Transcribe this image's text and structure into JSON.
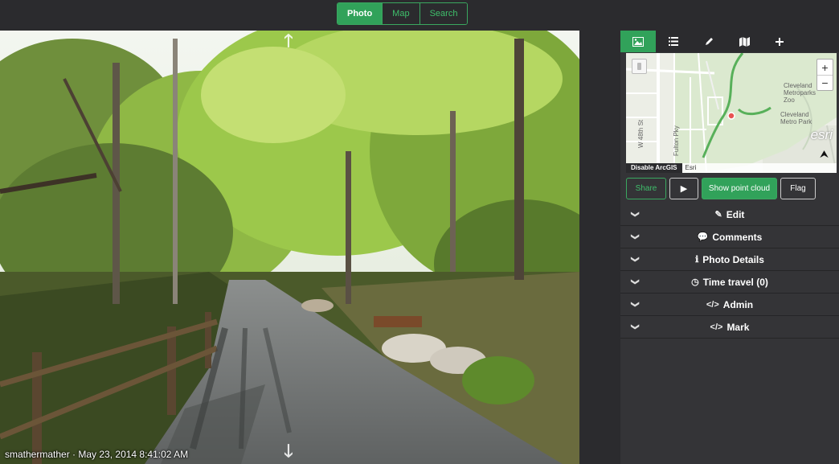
{
  "mode_tabs": [
    {
      "label": "Photo",
      "active": true
    },
    {
      "label": "Map",
      "active": false
    },
    {
      "label": "Search",
      "active": false
    }
  ],
  "viewer": {
    "caption_user": "smathermather",
    "caption_separator": " · ",
    "caption_date": "May 23, 2014 8:41:02 AM",
    "nav_up_icon": "arrow-up-icon",
    "nav_down_icon": "arrow-down-icon"
  },
  "panel": {
    "tabs": [
      {
        "icon": "image-icon",
        "active": true
      },
      {
        "icon": "list-icon",
        "active": false
      },
      {
        "icon": "pencil-icon",
        "active": false
      },
      {
        "icon": "map-icon",
        "active": false
      },
      {
        "icon": "plus-icon",
        "active": false
      }
    ],
    "minimap": {
      "zoom_in": "+",
      "zoom_out": "−",
      "labels": {
        "zoo": "Cleveland\nMetroparks\nZoo",
        "metro_park": "Cleveland\nMetro Park",
        "street_48th": "W 48th St",
        "street_fulton": "Fulton Pky"
      },
      "esri_logo": "esri",
      "disable_label": "Disable ArcGIS",
      "attribution": "Esri"
    },
    "buttons": {
      "share": "Share",
      "play": "▶",
      "point_cloud": "Show point cloud",
      "flag": "Flag"
    },
    "sections": [
      {
        "label": "Edit",
        "icon": "✎",
        "icon_name": "pencil-icon"
      },
      {
        "label": "Comments",
        "icon": "💬",
        "icon_name": "comments-icon"
      },
      {
        "label": "Photo Details",
        "icon": "ℹ",
        "icon_name": "info-icon"
      },
      {
        "label": "Time travel (0)",
        "icon": "◷",
        "icon_name": "clock-icon"
      },
      {
        "label": "Admin",
        "icon": "</>",
        "icon_name": "code-icon"
      },
      {
        "label": "Mark",
        "icon": "</>",
        "icon_name": "code-icon"
      }
    ]
  },
  "colors": {
    "accent": "#31a25a",
    "background": "#2b2b2e",
    "panel": "#343437"
  }
}
